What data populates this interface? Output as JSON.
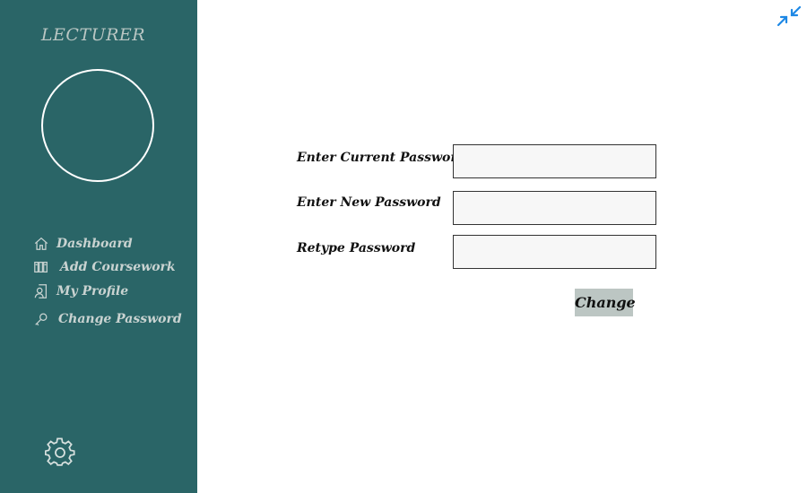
{
  "sidebar": {
    "role_title": "LECTURER",
    "nav": [
      {
        "label": "Dashboard",
        "icon": "home-icon"
      },
      {
        "label": "Add Coursework",
        "icon": "books-icon"
      },
      {
        "label": "My Profile",
        "icon": "profile-icon"
      },
      {
        "label": "Change Password",
        "icon": "key-icon"
      }
    ],
    "settings_icon": "gear-icon"
  },
  "header": {
    "collapse_icon": "collapse-arrows-icon"
  },
  "form": {
    "current_password_label": "Enter Current Password",
    "current_password_value": "",
    "new_password_label": "Enter New Password",
    "new_password_value": "",
    "retype_password_label": "Retype Password",
    "retype_password_value": "",
    "submit_label": "Change"
  },
  "colors": {
    "sidebar_bg": "#2a6567",
    "nav_text": "#c9d3d1",
    "button_bg": "#bcc6c3",
    "accent_icon": "#1e88e5"
  }
}
